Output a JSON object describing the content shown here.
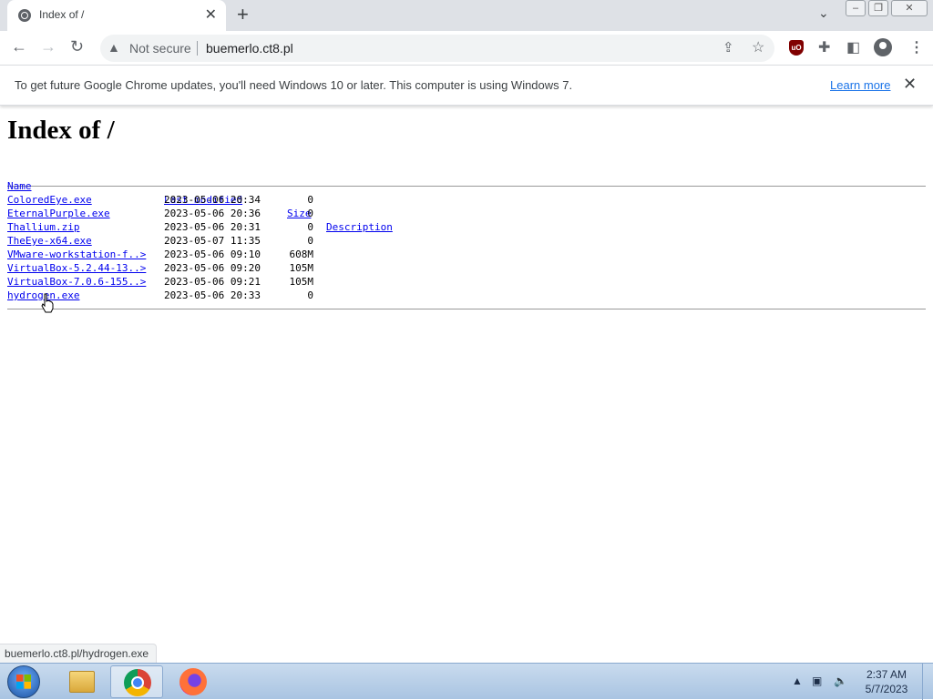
{
  "browser": {
    "tab_title": "Index of /",
    "address": {
      "security_label": "Not secure",
      "url": "buemerlo.ct8.pl"
    },
    "infobar": {
      "message": "To get future Google Chrome updates, you'll need Windows 10 or later. This computer is using Windows 7.",
      "learn_more": "Learn more"
    },
    "status_url": "buemerlo.ct8.pl/hydrogen.exe",
    "extension_badge": "uO"
  },
  "page": {
    "heading": "Index of /",
    "columns": {
      "name": "Name",
      "last_modified": "Last modified",
      "size": "Size",
      "description": "Description"
    },
    "files": [
      {
        "name": "ColoredEye.exe",
        "modified": "2023-05-06 20:34",
        "size": "0"
      },
      {
        "name": "EternalPurple.exe",
        "modified": "2023-05-06 20:36",
        "size": "0"
      },
      {
        "name": "Thallium.zip",
        "modified": "2023-05-06 20:31",
        "size": "0"
      },
      {
        "name": "TheEye-x64.exe",
        "modified": "2023-05-07 11:35",
        "size": "0"
      },
      {
        "name": "VMware-workstation-f..>",
        "modified": "2023-05-06 09:10",
        "size": "608M"
      },
      {
        "name": "VirtualBox-5.2.44-13..>",
        "modified": "2023-05-06 09:20",
        "size": "105M"
      },
      {
        "name": "VirtualBox-7.0.6-155..>",
        "modified": "2023-05-06 09:21",
        "size": "105M"
      },
      {
        "name": "hydrogen.exe",
        "modified": "2023-05-06 20:33",
        "size": "0"
      }
    ]
  },
  "taskbar": {
    "time": "2:37 AM",
    "date": "5/7/2023"
  }
}
